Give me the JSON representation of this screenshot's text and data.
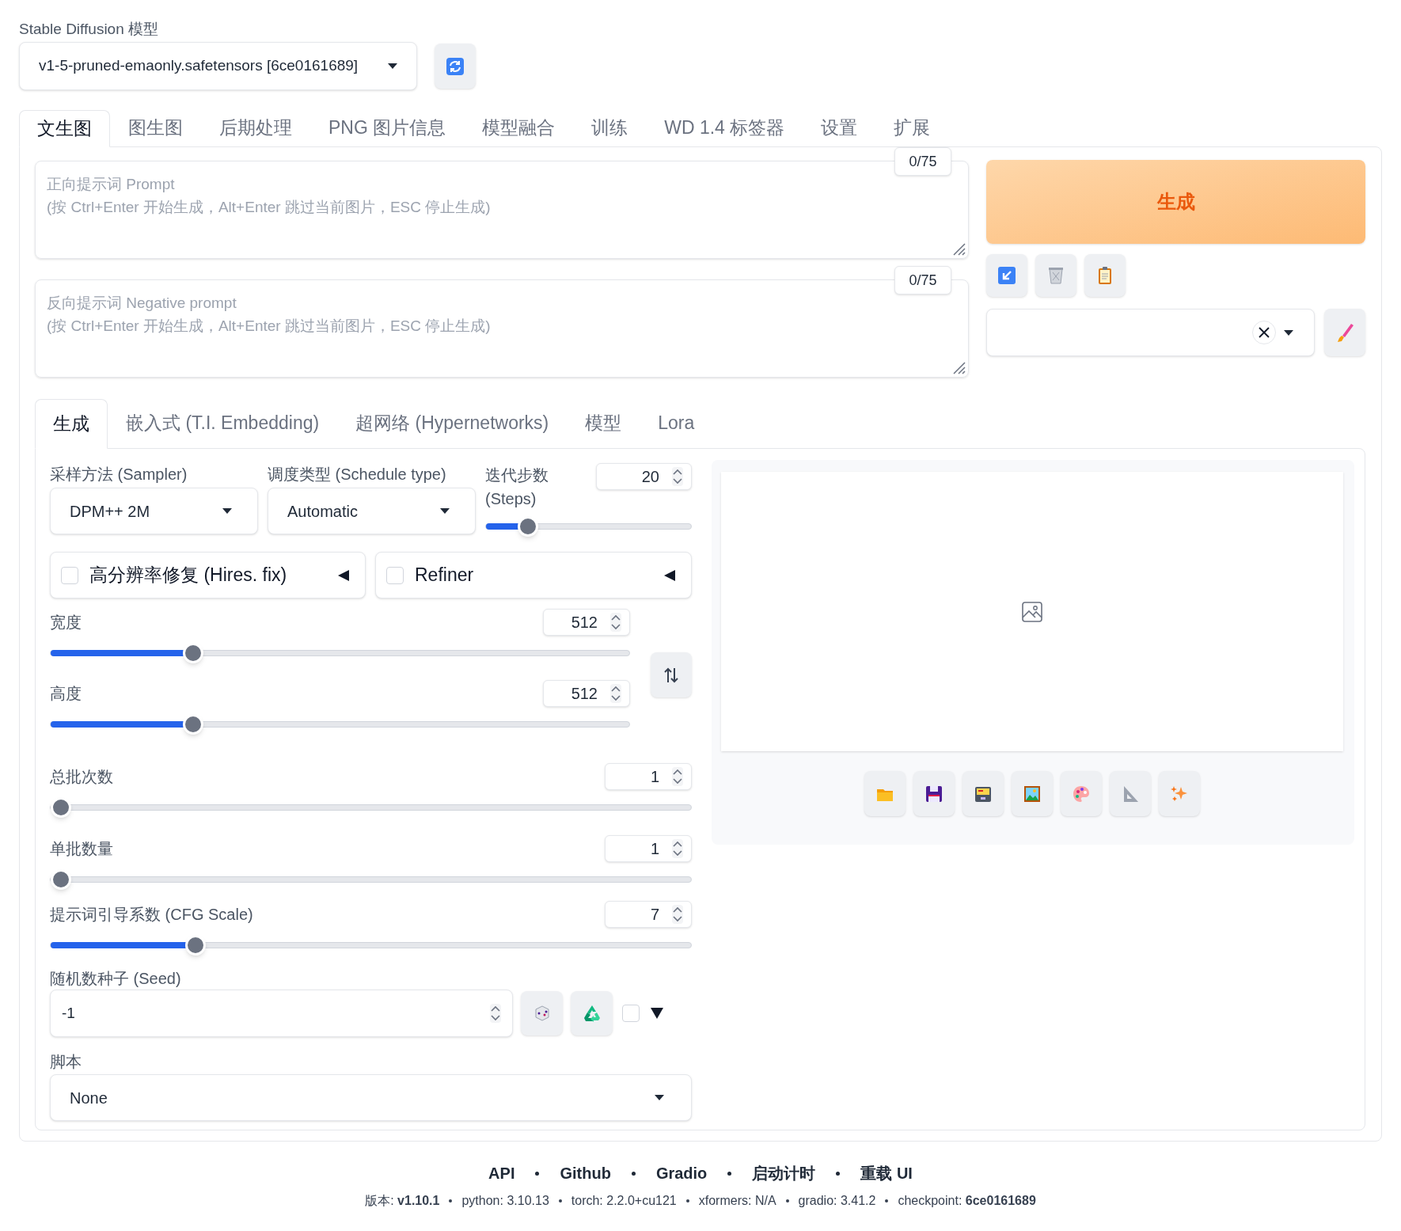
{
  "model": {
    "label": "Stable Diffusion 模型",
    "value": "v1-5-pruned-emaonly.safetensors [6ce0161689]"
  },
  "tabs": [
    {
      "label": "文生图",
      "selected": true
    },
    {
      "label": "图生图",
      "selected": false
    },
    {
      "label": "后期处理",
      "selected": false
    },
    {
      "label": "PNG 图片信息",
      "selected": false
    },
    {
      "label": "模型融合",
      "selected": false
    },
    {
      "label": "训练",
      "selected": false
    },
    {
      "label": "WD 1.4 标签器",
      "selected": false
    },
    {
      "label": "设置",
      "selected": false
    },
    {
      "label": "扩展",
      "selected": false
    }
  ],
  "prompts": [
    {
      "placeholder": "正向提示词 Prompt\n(按 Ctrl+Enter 开始生成，Alt+Enter 跳过当前图片，ESC 停止生成)",
      "counter": "0/75"
    },
    {
      "placeholder": "反向提示词 Negative prompt\n(按 Ctrl+Enter 开始生成，Alt+Enter 跳过当前图片，ESC 停止生成)",
      "counter": "0/75"
    }
  ],
  "generate_button": "生成",
  "subtabs": [
    {
      "label": "生成",
      "selected": true
    },
    {
      "label": "嵌入式 (T.I. Embedding)",
      "selected": false
    },
    {
      "label": "超网络 (Hypernetworks)",
      "selected": false
    },
    {
      "label": "模型",
      "selected": false
    },
    {
      "label": "Lora",
      "selected": false
    }
  ],
  "sampler": {
    "label": "采样方法 (Sampler)",
    "value": "DPM++ 2M"
  },
  "schedule": {
    "label": "调度类型 (Schedule type)",
    "value": "Automatic"
  },
  "steps": {
    "label": "迭代步数\n(Steps)",
    "value": "20",
    "level": 0.17
  },
  "accordions": [
    {
      "label": "高分辨率修复 (Hires. fix)",
      "checked": false
    },
    {
      "label": "Refiner",
      "checked": false
    }
  ],
  "size": [
    {
      "label": "宽度",
      "value": "512",
      "level": 0.237
    },
    {
      "label": "高度",
      "value": "512",
      "level": 0.237
    }
  ],
  "sliders": [
    {
      "label": "总批次数",
      "value": "1",
      "level": 0
    },
    {
      "label": "单批数量",
      "value": "1",
      "level": 0
    },
    {
      "label": "提示词引导系数 (CFG Scale)",
      "value": "7",
      "level": 0.217
    }
  ],
  "seed": {
    "label": "随机数种子 (Seed)",
    "value": "-1",
    "extra_checked": false
  },
  "script": {
    "label": "脚本",
    "value": "None"
  },
  "footer": {
    "links": [
      "API",
      "Github",
      "Gradio",
      "启动计时",
      "重载 UI"
    ],
    "versions": [
      "版本: **v1.10.1**",
      "python: 3.10.13",
      "torch: 2.2.0+cu121",
      "xformers: N/A",
      "gradio: 3.41.2",
      "checkpoint: **6ce0161689**"
    ]
  }
}
